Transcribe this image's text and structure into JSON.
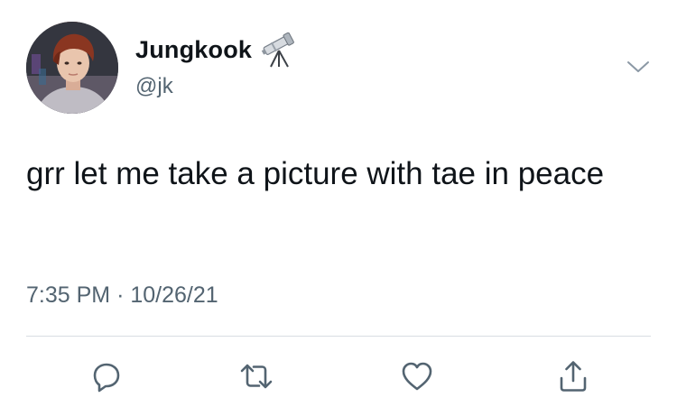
{
  "tweet": {
    "author": {
      "display_name": "Jungkook",
      "name_emoji": "telescope-icon",
      "handle": "@jk"
    },
    "text": "grr let me take a picture with tae in peace",
    "time": "7:35 PM",
    "separator": "·",
    "date": "10/26/21"
  },
  "actions": [
    {
      "name": "reply",
      "icon": "reply-icon"
    },
    {
      "name": "retweet",
      "icon": "retweet-icon"
    },
    {
      "name": "like",
      "icon": "heart-icon"
    },
    {
      "name": "share",
      "icon": "share-icon"
    }
  ],
  "colors": {
    "text_primary": "#0f1419",
    "text_secondary": "#536471",
    "divider": "#d8dde2",
    "icon": "#536471"
  }
}
